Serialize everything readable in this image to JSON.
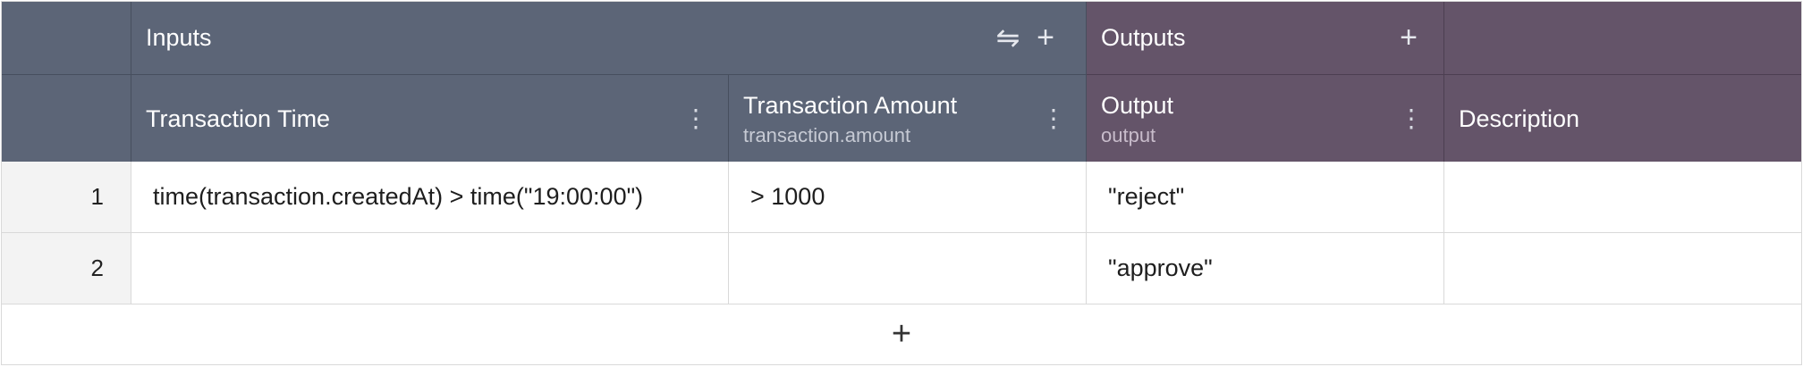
{
  "header": {
    "inputs_label": "Inputs",
    "outputs_label": "Outputs",
    "swap_icon": "⇋",
    "add_icon": "+"
  },
  "columns": {
    "transaction_time": {
      "title": "Transaction Time",
      "field": ""
    },
    "transaction_amount": {
      "title": "Transaction Amount",
      "field": "transaction.amount"
    },
    "output": {
      "title": "Output",
      "field": "output"
    },
    "description": {
      "title": "Description"
    },
    "menu_icon": "⋮"
  },
  "rows": [
    {
      "num": "1",
      "time": "time(transaction.createdAt) > time(\"19:00:00\")",
      "amount": "> 1000",
      "output": "\"reject\"",
      "description": ""
    },
    {
      "num": "2",
      "time": "",
      "amount": "",
      "output": "\"approve\"",
      "description": ""
    }
  ],
  "add_row_icon": "+",
  "colors": {
    "input_header": "#5c6577",
    "output_header": "#645469"
  }
}
